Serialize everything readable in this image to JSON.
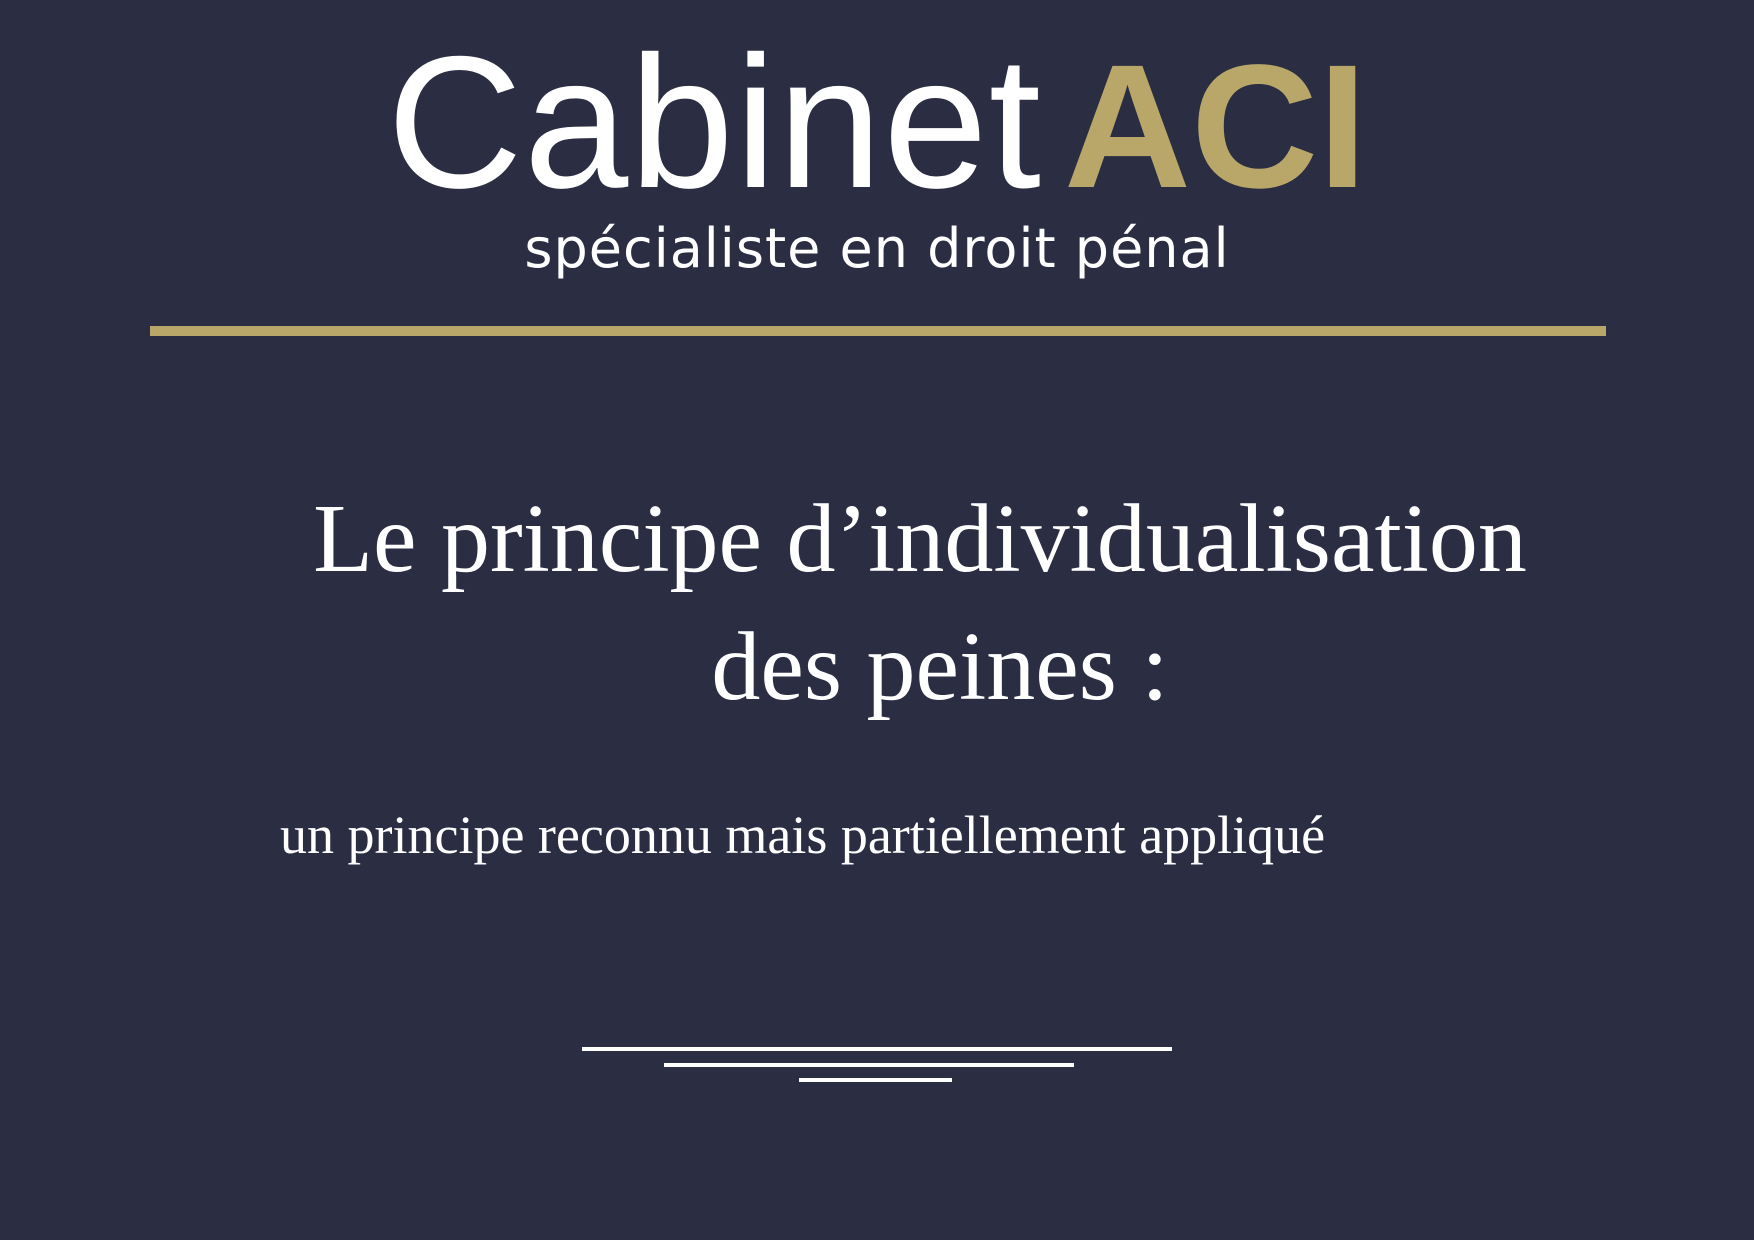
{
  "brand": {
    "name_light": "Cabinet",
    "name_bold": "ACI",
    "tagline": "spécialiste en droit pénal"
  },
  "colors": {
    "background": "#2b2d42",
    "accent_gold": "#b9a76a",
    "text": "#ffffff"
  },
  "headline": {
    "line1": "Le principe d’individualisation",
    "line2": "des peines :"
  },
  "subheadline": "un principe reconnu mais partiellement appliqué"
}
